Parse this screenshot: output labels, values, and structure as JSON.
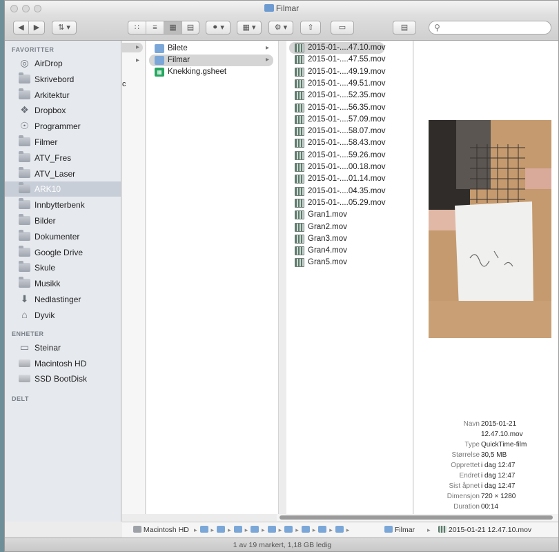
{
  "window": {
    "title": "Filmar"
  },
  "toolbar": {
    "back_icon": "chevron-left",
    "forward_icon": "chevron-right",
    "views": [
      "icon-view",
      "list-view",
      "column-view",
      "coverflow-view"
    ],
    "search_placeholder": ""
  },
  "sidebar": {
    "favourites_heading": "FAVORITTER",
    "favourites": [
      {
        "label": "AirDrop",
        "icon": "airdrop"
      },
      {
        "label": "Skrivebord",
        "icon": "folder"
      },
      {
        "label": "Arkitektur",
        "icon": "folder"
      },
      {
        "label": "Dropbox",
        "icon": "dropbox"
      },
      {
        "label": "Programmer",
        "icon": "applications"
      },
      {
        "label": "Filmer",
        "icon": "folder"
      },
      {
        "label": "ATV_Fres",
        "icon": "folder"
      },
      {
        "label": "ATV_Laser",
        "icon": "folder"
      },
      {
        "label": "ARK10",
        "icon": "folder",
        "selected": true
      },
      {
        "label": "Innbytterbenk",
        "icon": "folder"
      },
      {
        "label": "Bilder",
        "icon": "folder"
      },
      {
        "label": "Dokumenter",
        "icon": "folder"
      },
      {
        "label": "Google Drive",
        "icon": "folder"
      },
      {
        "label": "Skule",
        "icon": "folder"
      },
      {
        "label": "Musikk",
        "icon": "folder"
      },
      {
        "label": "Nedlastinger",
        "icon": "download"
      },
      {
        "label": "Dyvik",
        "icon": "home"
      }
    ],
    "devices_heading": "ENHETER",
    "devices": [
      {
        "label": "Steinar",
        "icon": "computer"
      },
      {
        "label": "Macintosh HD",
        "icon": "drive"
      },
      {
        "label": "SSD BootDisk",
        "icon": "drive"
      }
    ],
    "shared_heading": "DELT"
  },
  "column1": {
    "fragment": "c"
  },
  "column2": {
    "items": [
      {
        "name": "Bilete",
        "type": "folder"
      },
      {
        "name": "Filmar",
        "type": "folder",
        "selected": true
      },
      {
        "name": "Knekking.gsheet",
        "type": "sheet"
      }
    ]
  },
  "column3": {
    "items": [
      {
        "name": "2015-01-....47.10.mov",
        "selected": true
      },
      {
        "name": "2015-01-....47.55.mov"
      },
      {
        "name": "2015-01-....49.19.mov"
      },
      {
        "name": "2015-01-....49.51.mov"
      },
      {
        "name": "2015-01-....52.35.mov"
      },
      {
        "name": "2015-01-....56.35.mov"
      },
      {
        "name": "2015-01-....57.09.mov"
      },
      {
        "name": "2015-01-....58.07.mov"
      },
      {
        "name": "2015-01-....58.43.mov"
      },
      {
        "name": "2015-01-....59.26.mov"
      },
      {
        "name": "2015-01-....00.18.mov"
      },
      {
        "name": "2015-01-....01.14.mov"
      },
      {
        "name": "2015-01-....04.35.mov"
      },
      {
        "name": "2015-01-....05.29.mov"
      },
      {
        "name": "Gran1.mov"
      },
      {
        "name": "Gran2.mov"
      },
      {
        "name": "Gran3.mov"
      },
      {
        "name": "Gran4.mov"
      },
      {
        "name": "Gran5.mov"
      }
    ]
  },
  "preview": {
    "info": [
      {
        "key": "Navn",
        "value": "2015-01-21"
      },
      {
        "key": "",
        "value": "12.47.10.mov"
      },
      {
        "key": "Type",
        "value": "QuickTime-film"
      },
      {
        "key": "Størrelse",
        "value": "30,5 MB"
      },
      {
        "key": "Opprettet",
        "value": "i dag 12:47"
      },
      {
        "key": "Endret",
        "value": "i dag 12:47"
      },
      {
        "key": "Sist åpnet",
        "value": "i dag 12:47"
      },
      {
        "key": "Dimensjon",
        "value": "720 × 1280"
      },
      {
        "key": "Duration",
        "value": "00:14"
      }
    ]
  },
  "pathbar": {
    "start": "Macintosh HD",
    "intermediate_folders": 9,
    "folder": "Filmar",
    "file": "2015-01-21 12.47.10.mov"
  },
  "status": {
    "text": "1 av 19 markert, 1,18 GB ledig"
  },
  "colors": {
    "selection": "#d5d5d5",
    "sidebar_selection": "#c8ced8",
    "folder": "#7ba7d8"
  }
}
